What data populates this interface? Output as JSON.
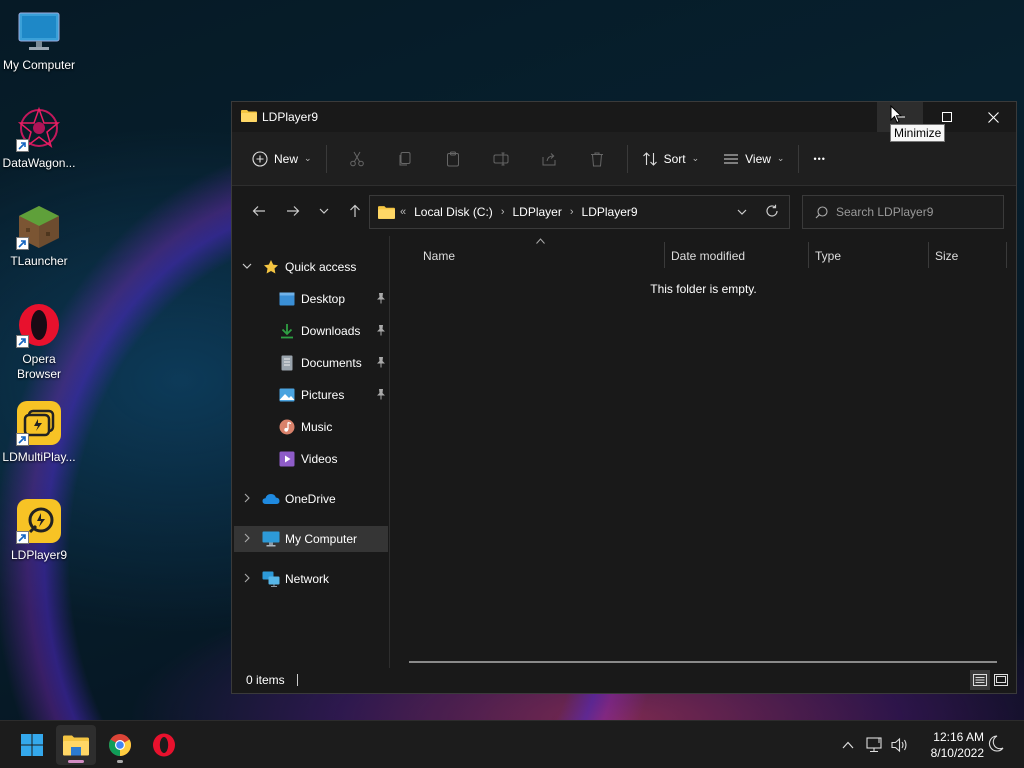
{
  "desktop": {
    "icons": [
      {
        "label": "My Computer"
      },
      {
        "label": "DataWagon..."
      },
      {
        "label": "TLauncher"
      },
      {
        "label": "Opera\nBrowser"
      },
      {
        "label": "LDMultiPlay..."
      },
      {
        "label": "LDPlayer9"
      }
    ]
  },
  "window": {
    "title": "LDPlayer9",
    "tooltip": "Minimize",
    "toolbar": {
      "new_label": "New",
      "sort_label": "Sort",
      "view_label": "View",
      "more_label": "•••"
    },
    "address": {
      "overflow": "«",
      "crumbs": [
        "Local Disk (C:)",
        "LDPlayer",
        "LDPlayer9"
      ],
      "separator": "›"
    },
    "search": {
      "placeholder": "Search LDPlayer9"
    },
    "nav": {
      "quick_access": "Quick access",
      "items": [
        {
          "label": "Desktop",
          "pinned": true
        },
        {
          "label": "Downloads",
          "pinned": true
        },
        {
          "label": "Documents",
          "pinned": true
        },
        {
          "label": "Pictures",
          "pinned": true
        },
        {
          "label": "Music",
          "pinned": false
        },
        {
          "label": "Videos",
          "pinned": false
        }
      ],
      "onedrive": "OneDrive",
      "my_computer": "My Computer",
      "network": "Network"
    },
    "columns": {
      "name": "Name",
      "date": "Date modified",
      "type": "Type",
      "size": "Size"
    },
    "empty_message": "This folder is empty.",
    "status": {
      "item_count": "0 items"
    }
  },
  "taskbar": {
    "clock_time": "12:16 AM",
    "clock_date": "8/10/2022"
  },
  "colors": {
    "window_bg": "#191919",
    "accent_folder": "#f4c542",
    "selection": "#353535"
  }
}
